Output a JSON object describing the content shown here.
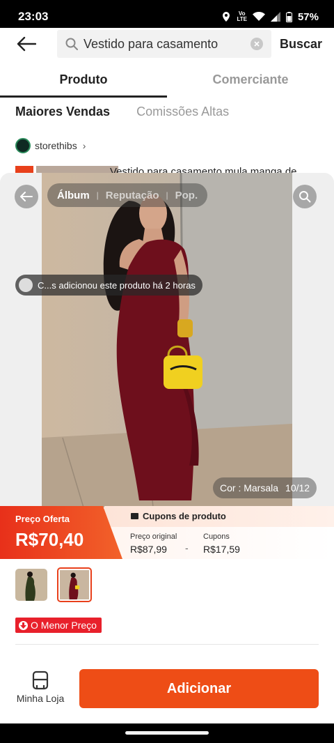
{
  "status": {
    "time": "23:03",
    "network_label_top": "Vo",
    "network_label_bottom": "LTE",
    "battery": "57%"
  },
  "header": {
    "search_query": "Vestido para casamento",
    "search_button": "Buscar"
  },
  "tabs": [
    {
      "label": "Produto",
      "active": true
    },
    {
      "label": "Comerciante",
      "active": false
    }
  ],
  "sort": {
    "primary": "Maiores Vendas",
    "secondary": "Comissões Altas"
  },
  "store": {
    "name": "storethibs"
  },
  "result_peek": {
    "title": "Vestido para casamento mula manga de"
  },
  "product_sheet": {
    "media_tabs": [
      "Álbum",
      "Reputação",
      "Pop."
    ],
    "toast": "C...s adicionou este produto há 2 horas",
    "variant_label": "Cor : Marsala",
    "image_counter": "10/12",
    "price_label": "Preço Oferta",
    "price_value": "R$70,40",
    "coupon_header": "Cupons de produto",
    "original_price_label": "Preço original",
    "original_price_value": "R$87,99",
    "coupon_label": "Cupons",
    "coupon_value": "R$17,59",
    "minus_sign": "-",
    "lowest_price_badge": "O Menor Preço",
    "colors": {
      "accent": "#ee4d16",
      "price_red": "#e8301a",
      "dress": "#6e0f1c",
      "bag": "#f0d020"
    }
  },
  "bottom_bar": {
    "shop_label": "Minha Loja",
    "add_button": "Adicionar"
  }
}
